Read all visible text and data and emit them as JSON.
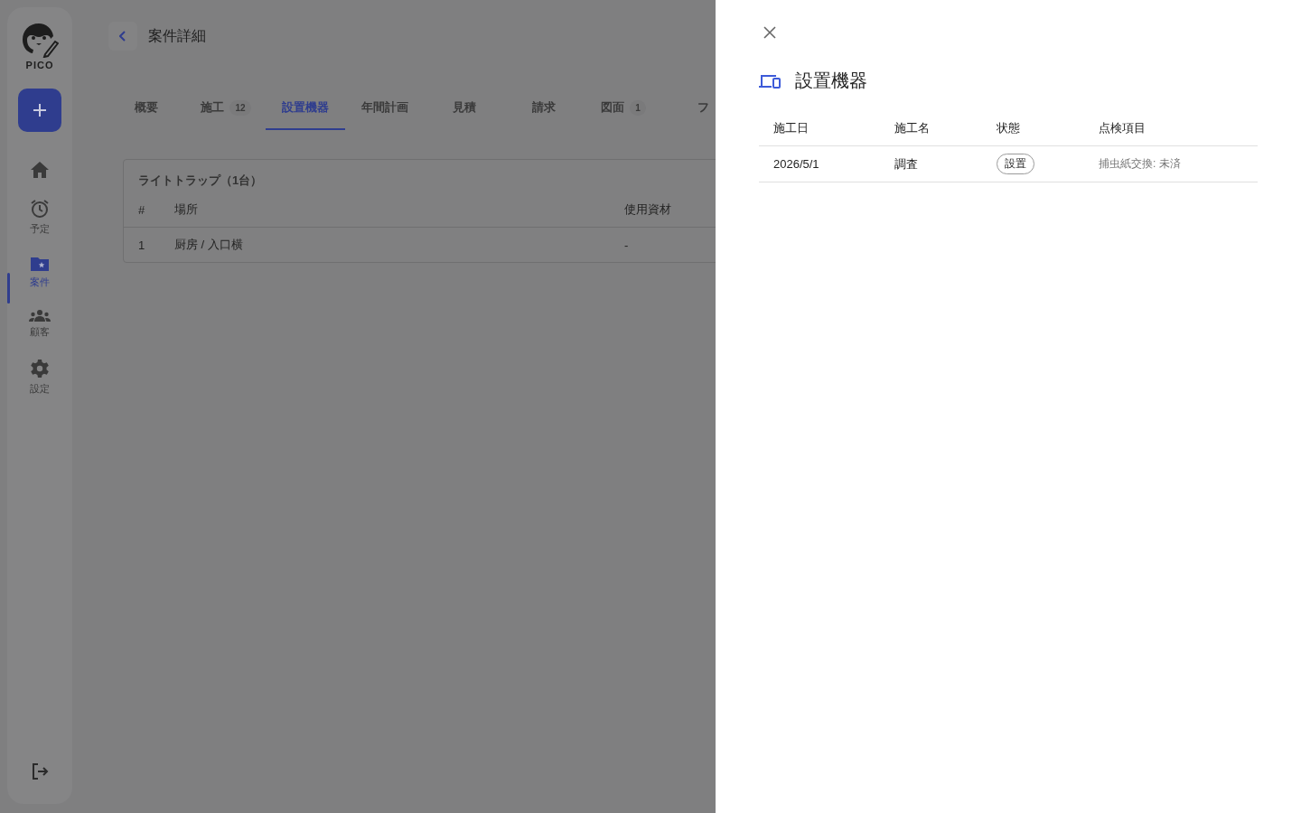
{
  "sidebar": {
    "logo_text": "PICO",
    "items": [
      {
        "kind": "home",
        "selected": false
      },
      {
        "kind": "clock",
        "label": "予定",
        "selected": false
      },
      {
        "kind": "folder",
        "label": "案件",
        "selected": true
      },
      {
        "kind": "people",
        "label": "顧客",
        "selected": false
      },
      {
        "kind": "gear",
        "label": "設定",
        "selected": false
      }
    ]
  },
  "header": {
    "title": "案件詳細"
  },
  "tabs": [
    {
      "label": "概要",
      "selected": false
    },
    {
      "label": "施工",
      "count": "12",
      "selected": false
    },
    {
      "label": "設置機器",
      "selected": true
    },
    {
      "label": "年間計画",
      "selected": false
    },
    {
      "label": "見積",
      "selected": false
    },
    {
      "label": "請求",
      "selected": false
    },
    {
      "label": "図面",
      "count": "1",
      "selected": false
    },
    {
      "label": "フ",
      "selected": false
    }
  ],
  "section": {
    "title": "ライトトラップ（1台）",
    "columns": [
      "#",
      "場所",
      "使用資材"
    ],
    "rows": [
      [
        "1",
        "厨房 / 入口横",
        "-"
      ]
    ]
  },
  "drawer": {
    "title": "設置機器",
    "columns": [
      "施工日",
      "施工名",
      "状態",
      "点検項目"
    ],
    "rows": [
      {
        "date": "2026/5/1",
        "name": "調査",
        "status": "設置",
        "check": "捕虫紙交換: 未済"
      }
    ]
  }
}
